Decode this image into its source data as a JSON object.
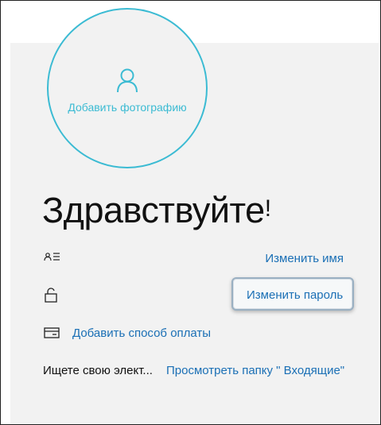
{
  "profile": {
    "add_photo_label": "Добавить фотографию",
    "greeting_text": "Здравствуйте",
    "greeting_punct": "!"
  },
  "actions": {
    "change_name": "Изменить имя",
    "change_password": "Изменить пароль",
    "add_payment": "Добавить способ оплаты"
  },
  "email": {
    "prompt": "Ищете свою элект...",
    "view_inbox": "Просмотреть папку \" Входящие\""
  },
  "colors": {
    "accent": "#3bbbd3",
    "link": "#1a6fb5",
    "panel_bg": "#f2f2f2"
  },
  "icons": {
    "person": "person-icon",
    "name": "name-icon",
    "lock": "lock-icon",
    "card": "card-icon"
  }
}
